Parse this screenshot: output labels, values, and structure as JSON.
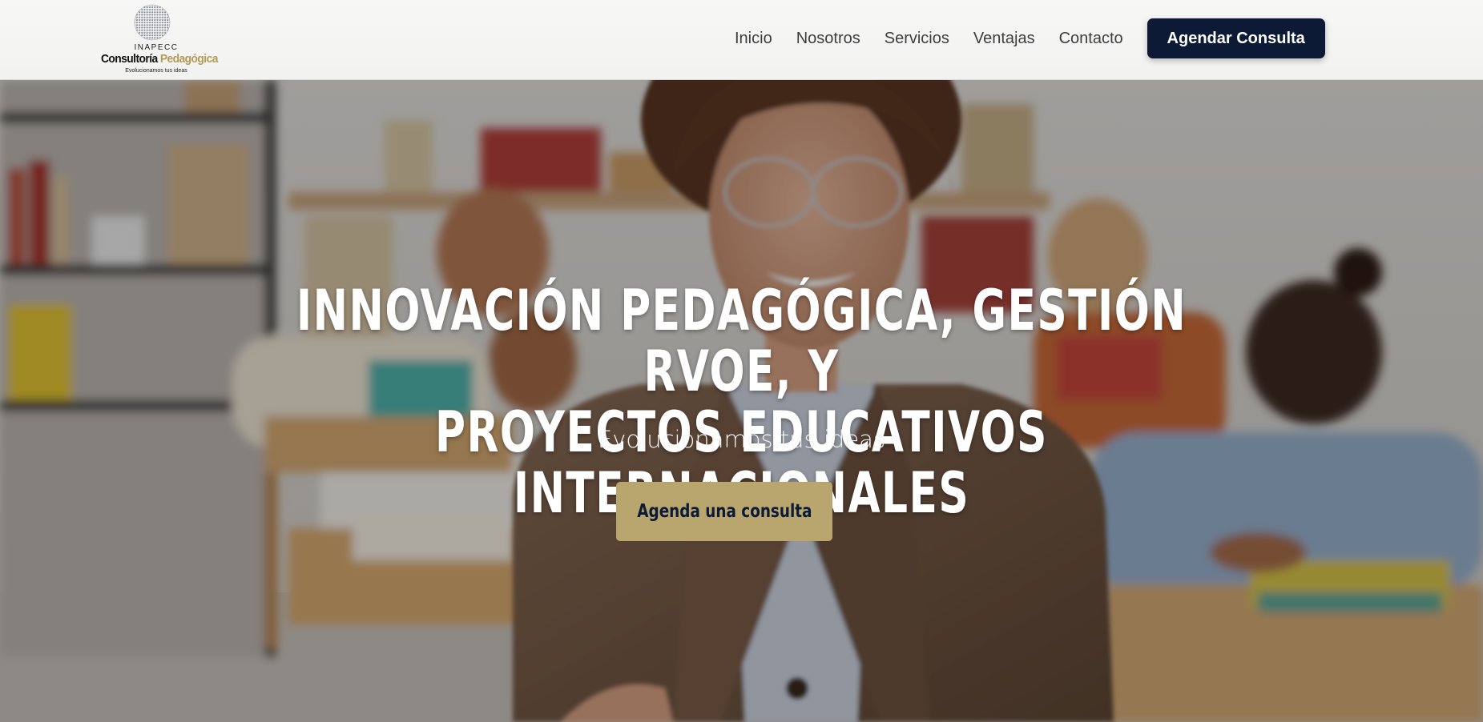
{
  "header": {
    "logo": {
      "abbr": "INAPECC",
      "name_part1": "Consultoría",
      "name_part2": "Pedagógica",
      "tagline": "Evolucionamos tus ideas"
    },
    "nav": [
      {
        "label": "Inicio"
      },
      {
        "label": "Nosotros"
      },
      {
        "label": "Servicios"
      },
      {
        "label": "Ventajas"
      },
      {
        "label": "Contacto"
      }
    ],
    "cta_label": "Agendar Consulta"
  },
  "hero": {
    "title_line1": "INNOVACIÓN PEDAGÓGICA, GESTIÓN RVOE, Y",
    "title_line2": "PROYECTOS EDUCATIVOS INTERNACIONALES",
    "subtitle": "Evolucionamos tus ideas",
    "cta_label": "Agenda una consulta"
  },
  "colors": {
    "brand_navy": "#0c1a36",
    "brand_gold": "#b9a66e",
    "logo_gold": "#b39a55",
    "nav_text": "#3e3e3e"
  },
  "icons": {
    "logo_mark": "globe-dots-icon"
  }
}
